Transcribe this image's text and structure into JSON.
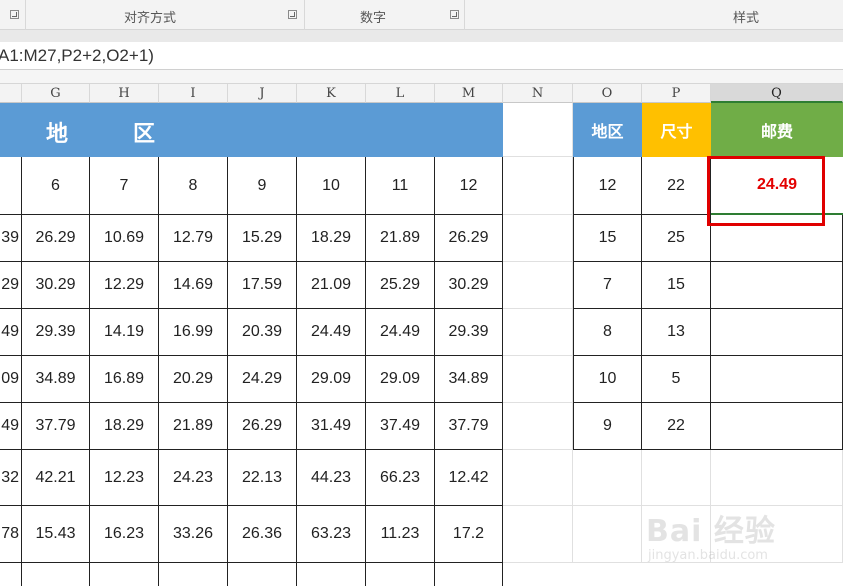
{
  "ribbon": {
    "groups": [
      {
        "label": "对齐方式"
      },
      {
        "label": "数字"
      },
      {
        "label": "样式"
      }
    ]
  },
  "formula_bar": {
    "text": "A1:M27,P2+2,O2+1)"
  },
  "column_headers": [
    "G",
    "H",
    "I",
    "J",
    "K",
    "L",
    "M",
    "N",
    "O",
    "P",
    "Q"
  ],
  "selected_column": "Q",
  "banner": {
    "char1": "地",
    "char2": "区"
  },
  "lookup_headers": {
    "region": "地区",
    "size": "尺寸",
    "postage": "邮费"
  },
  "lookup_result": "24.49",
  "region_header_numbers": [
    "6",
    "7",
    "8",
    "9",
    "10",
    "11",
    "12"
  ],
  "rows": [
    {
      "a": "39",
      "cells": [
        "26.29",
        "10.69",
        "12.79",
        "15.29",
        "18.29",
        "21.89",
        "26.29"
      ]
    },
    {
      "a": "29",
      "cells": [
        "30.29",
        "12.29",
        "14.69",
        "17.59",
        "21.09",
        "25.29",
        "30.29"
      ]
    },
    {
      "a": "49",
      "cells": [
        "29.39",
        "14.19",
        "16.99",
        "20.39",
        "24.49",
        "24.49",
        "29.39"
      ]
    },
    {
      "a": "09",
      "cells": [
        "34.89",
        "16.89",
        "20.29",
        "24.29",
        "29.09",
        "29.09",
        "34.89"
      ]
    },
    {
      "a": "49",
      "cells": [
        "37.79",
        "18.29",
        "21.89",
        "26.29",
        "31.49",
        "37.49",
        "37.79"
      ]
    },
    {
      "a": "32",
      "cells": [
        "42.21",
        "12.23",
        "24.23",
        "22.13",
        "44.23",
        "66.23",
        "12.42"
      ]
    },
    {
      "a": "78",
      "cells": [
        "15.43",
        "16.23",
        "33.26",
        "26.36",
        "63.23",
        "11.23",
        "17.2"
      ]
    }
  ],
  "lookup_rows": [
    {
      "region": "12",
      "size": "22"
    },
    {
      "region": "15",
      "size": "25"
    },
    {
      "region": "7",
      "size": "15"
    },
    {
      "region": "8",
      "size": "13"
    },
    {
      "region": "10",
      "size": "5"
    },
    {
      "region": "9",
      "size": "22"
    }
  ],
  "watermark": {
    "brand": "Bai 经验",
    "url": "jingyan.baidu.com"
  },
  "colors": {
    "banner_blue": "#5b9bd5",
    "size_yellow": "#ffc000",
    "postage_green": "#70ad47",
    "result_red": "#e30000",
    "highlight_box": "#e00000"
  }
}
